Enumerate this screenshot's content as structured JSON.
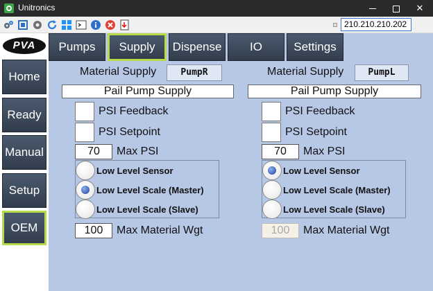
{
  "window": {
    "title": "Unitronics"
  },
  "toolbar": {
    "ip_address": "210.210.210.202"
  },
  "logo_text": "PVA",
  "nav": [
    {
      "label": "Home"
    },
    {
      "label": "Ready"
    },
    {
      "label": "Manual"
    },
    {
      "label": "Setup"
    },
    {
      "label": "OEM",
      "active": true
    }
  ],
  "tabs": [
    {
      "label": "Pumps"
    },
    {
      "label": "Supply",
      "active": true
    },
    {
      "label": "Dispense"
    },
    {
      "label": "IO"
    },
    {
      "label": "Settings"
    }
  ],
  "left": {
    "material_supply_label": "Material Supply",
    "pump": "PumpR",
    "supply_type": "Pail Pump Supply",
    "psi_feedback_label": "PSI Feedback",
    "psi_setpoint_label": "PSI Setpoint",
    "max_psi_value": "70",
    "max_psi_label": "Max PSI",
    "radio_options": [
      "Low Level Sensor",
      "Low Level Scale (Master)",
      "Low Level Scale (Slave)"
    ],
    "selected_option": "Low Level Scale (Master)",
    "max_wgt_value": "100",
    "max_wgt_label": "Max Material Wgt"
  },
  "right": {
    "material_supply_label": "Material Supply",
    "pump": "PumpL",
    "supply_type": "Pail Pump Supply",
    "psi_feedback_label": "PSI Feedback",
    "psi_setpoint_label": "PSI Setpoint",
    "max_psi_value": "70",
    "max_psi_label": "Max PSI",
    "radio_options": [
      "Low Level Sensor",
      "Low Level Scale (Master)",
      "Low Level Scale (Slave)"
    ],
    "selected_option": "Low Level Sensor",
    "max_wgt_value": "100",
    "max_wgt_label": "Max Material Wgt"
  }
}
